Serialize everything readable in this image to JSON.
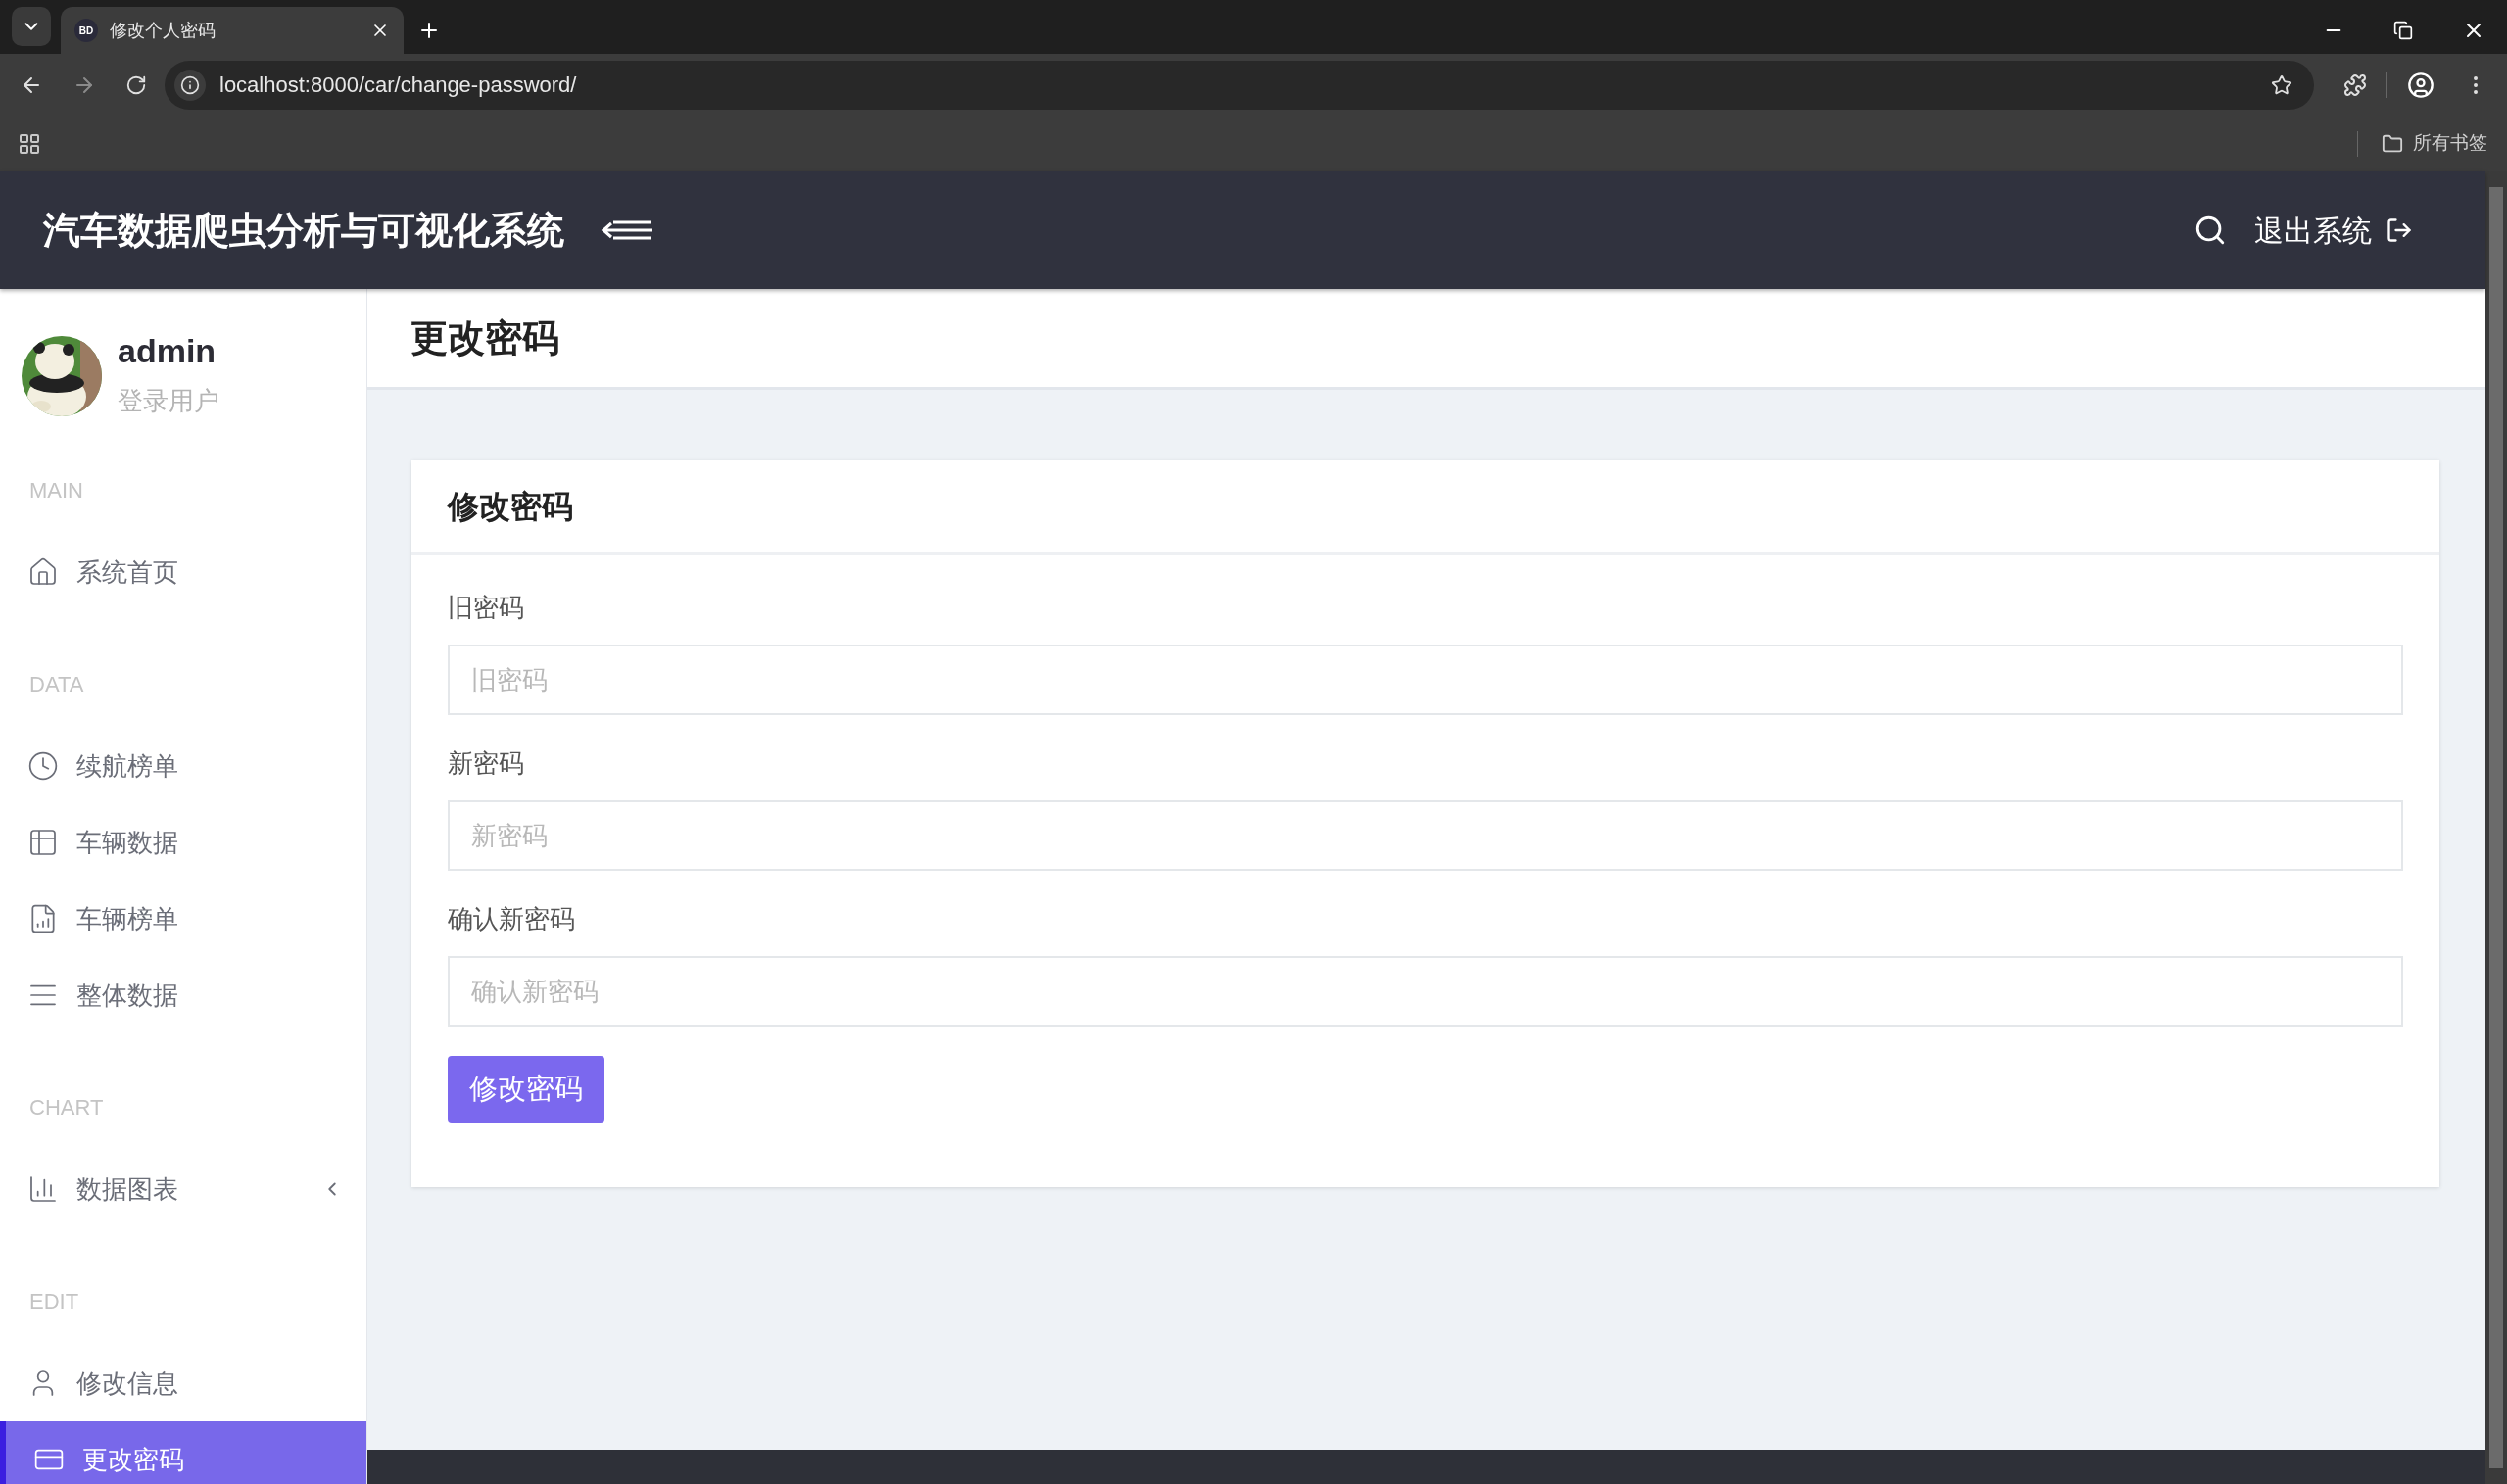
{
  "browser": {
    "tab": {
      "favicon": "BD",
      "title": "修改个人密码"
    },
    "url": "localhost:8000/car/change-password/",
    "bookmarks": "所有书签"
  },
  "header": {
    "title": "汽车数据爬虫分析与可视化系统",
    "logout": "退出系统"
  },
  "user": {
    "name": "admin",
    "role": "登录用户"
  },
  "sidebar": [
    {
      "label": "MAIN",
      "items": [
        {
          "text": "系统首页",
          "selected": false
        }
      ]
    },
    {
      "label": "DATA",
      "items": [
        {
          "text": "续航榜单",
          "selected": false
        },
        {
          "text": "车辆数据",
          "selected": false
        },
        {
          "text": "车辆榜单",
          "selected": false
        },
        {
          "text": "整体数据",
          "selected": false
        }
      ]
    },
    {
      "label": "CHART",
      "items": [
        {
          "text": "数据图表",
          "selected": false,
          "expanded": false
        }
      ]
    },
    {
      "label": "EDIT",
      "items": [
        {
          "text": "修改信息",
          "selected": false
        },
        {
          "text": "更改密码",
          "selected": true
        }
      ]
    }
  ],
  "page_title": "更改密码",
  "form": {
    "title": "修改密码",
    "fields": [
      {
        "label": "旧密码",
        "placeholder": "旧密码"
      },
      {
        "label": "新密码",
        "placeholder": "新密码"
      },
      {
        "label": "确认新密码",
        "placeholder": "确认新密码"
      }
    ],
    "submit": "修改密码"
  }
}
